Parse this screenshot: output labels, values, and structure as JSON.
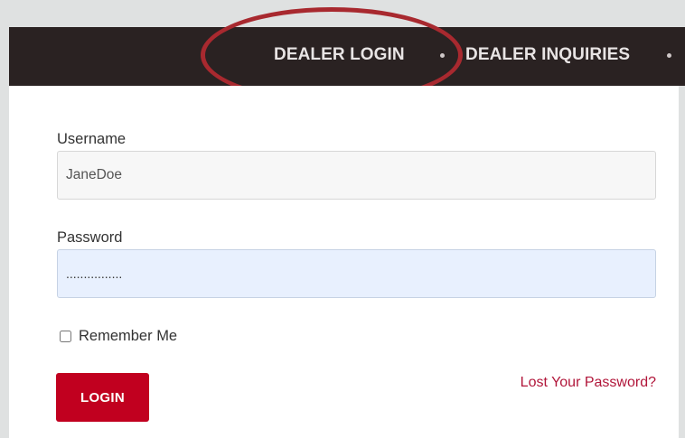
{
  "nav": {
    "items": [
      {
        "label": "DEALER LOGIN"
      },
      {
        "label": "DEALER INQUIRIES"
      }
    ]
  },
  "form": {
    "username_label": "Username",
    "username_value": "JaneDoe",
    "password_label": "Password",
    "password_value": "................",
    "remember_label": "Remember Me",
    "remember_checked": false,
    "login_button_label": "LOGIN",
    "lost_password_label": "Lost Your Password?"
  },
  "colors": {
    "nav_background": "#2a2222",
    "annotation_circle": "#a8292f",
    "login_button": "#c1001f",
    "link": "#b1163a",
    "password_autofill_background": "#e8f0fe"
  }
}
